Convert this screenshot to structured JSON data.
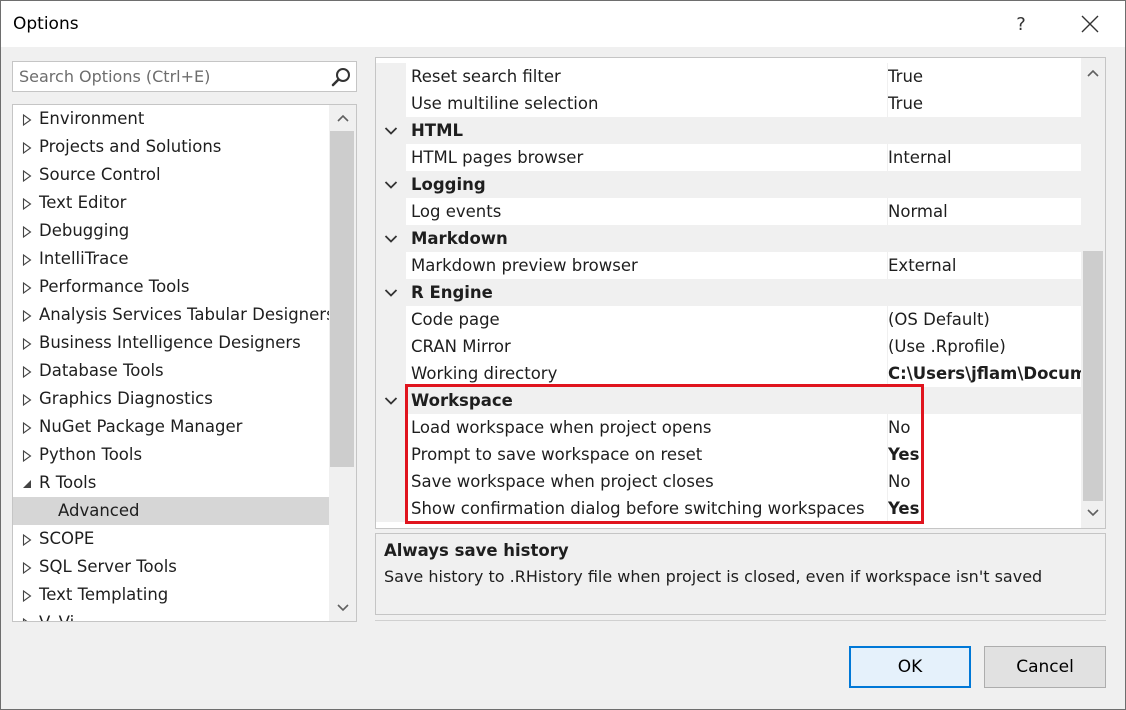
{
  "window": {
    "title": "Options",
    "help_label": "?"
  },
  "search": {
    "placeholder": "Search Options (Ctrl+E)"
  },
  "tree": {
    "items": [
      {
        "label": "Environment",
        "expanded": false
      },
      {
        "label": "Projects and Solutions",
        "expanded": false
      },
      {
        "label": "Source Control",
        "expanded": false
      },
      {
        "label": "Text Editor",
        "expanded": false
      },
      {
        "label": "Debugging",
        "expanded": false
      },
      {
        "label": "IntelliTrace",
        "expanded": false
      },
      {
        "label": "Performance Tools",
        "expanded": false
      },
      {
        "label": "Analysis Services Tabular Designers",
        "expanded": false
      },
      {
        "label": "Business Intelligence Designers",
        "expanded": false
      },
      {
        "label": "Database Tools",
        "expanded": false
      },
      {
        "label": "Graphics Diagnostics",
        "expanded": false
      },
      {
        "label": "NuGet Package Manager",
        "expanded": false
      },
      {
        "label": "Python Tools",
        "expanded": false
      },
      {
        "label": "R Tools",
        "expanded": true
      },
      {
        "label": "Advanced",
        "child": true,
        "selected": true
      },
      {
        "label": "SCOPE",
        "expanded": false
      },
      {
        "label": "SQL Server Tools",
        "expanded": false
      },
      {
        "label": "Text Templating",
        "expanded": false
      },
      {
        "label": "V. Vi...",
        "expanded": false
      }
    ]
  },
  "grid": {
    "rows": [
      {
        "type": "prop",
        "name": "Reset search filter",
        "value": "True"
      },
      {
        "type": "prop",
        "name": "Use multiline selection",
        "value": "True"
      },
      {
        "type": "cat",
        "name": "HTML"
      },
      {
        "type": "prop",
        "name": "HTML pages browser",
        "value": "Internal"
      },
      {
        "type": "cat",
        "name": "Logging"
      },
      {
        "type": "prop",
        "name": "Log events",
        "value": "Normal"
      },
      {
        "type": "cat",
        "name": "Markdown"
      },
      {
        "type": "prop",
        "name": "Markdown preview browser",
        "value": "External"
      },
      {
        "type": "cat",
        "name": "R Engine"
      },
      {
        "type": "prop",
        "name": "Code page",
        "value": "(OS Default)"
      },
      {
        "type": "prop",
        "name": "CRAN Mirror",
        "value": "(Use .Rprofile)"
      },
      {
        "type": "prop",
        "name": "Working directory",
        "value": "C:\\Users\\jflam\\Documents",
        "bold": true
      },
      {
        "type": "cat",
        "name": "Workspace"
      },
      {
        "type": "prop",
        "name": "Load workspace when project opens",
        "value": "No"
      },
      {
        "type": "prop",
        "name": "Prompt to save workspace on reset",
        "value": "Yes",
        "bold": true
      },
      {
        "type": "prop",
        "name": "Save workspace when project closes",
        "value": "No"
      },
      {
        "type": "prop",
        "name": "Show confirmation dialog before switching workspaces",
        "value": "Yes",
        "bold": true
      }
    ]
  },
  "description": {
    "title": "Always save history",
    "text": "Save history to .RHistory file when project is closed, even if workspace isn't saved"
  },
  "buttons": {
    "ok": "OK",
    "cancel": "Cancel"
  },
  "colors": {
    "highlight": "#e0141e",
    "accent": "#0078d7",
    "selected_bg": "#d6d6d6"
  }
}
